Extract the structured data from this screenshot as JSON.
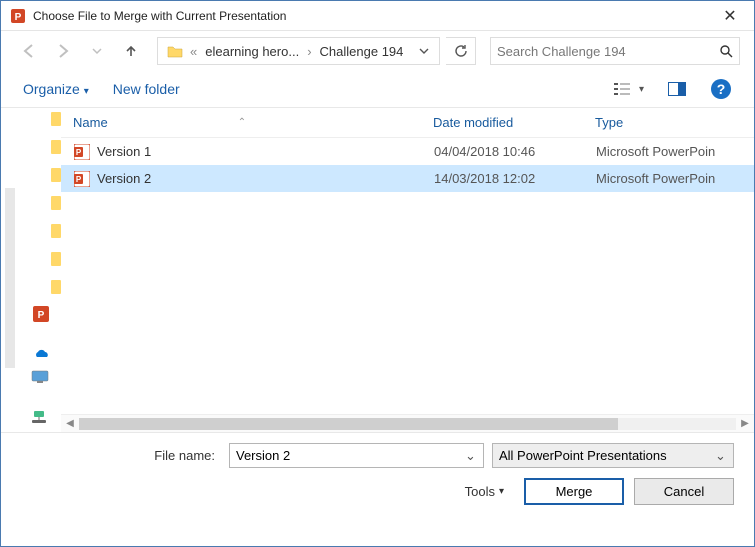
{
  "window": {
    "title": "Choose File to Merge with Current Presentation"
  },
  "nav": {
    "breadcrumb_prefix": "«",
    "crumb1": "elearning hero...",
    "crumb2": "Challenge 194",
    "search_placeholder": "Search Challenge 194"
  },
  "toolbar": {
    "organize": "Organize",
    "new_folder": "New folder"
  },
  "columns": {
    "name": "Name",
    "date": "Date modified",
    "type": "Type"
  },
  "files": [
    {
      "name": "Version 1",
      "date": "04/04/2018 10:46",
      "type": "Microsoft PowerPoin",
      "selected": false
    },
    {
      "name": "Version 2",
      "date": "14/03/2018 12:02",
      "type": "Microsoft PowerPoin",
      "selected": true
    }
  ],
  "footer": {
    "filename_label": "File name:",
    "filename_value": "Version 2",
    "filter": "All PowerPoint Presentations",
    "tools": "Tools",
    "open": "Merge",
    "cancel": "Cancel"
  }
}
